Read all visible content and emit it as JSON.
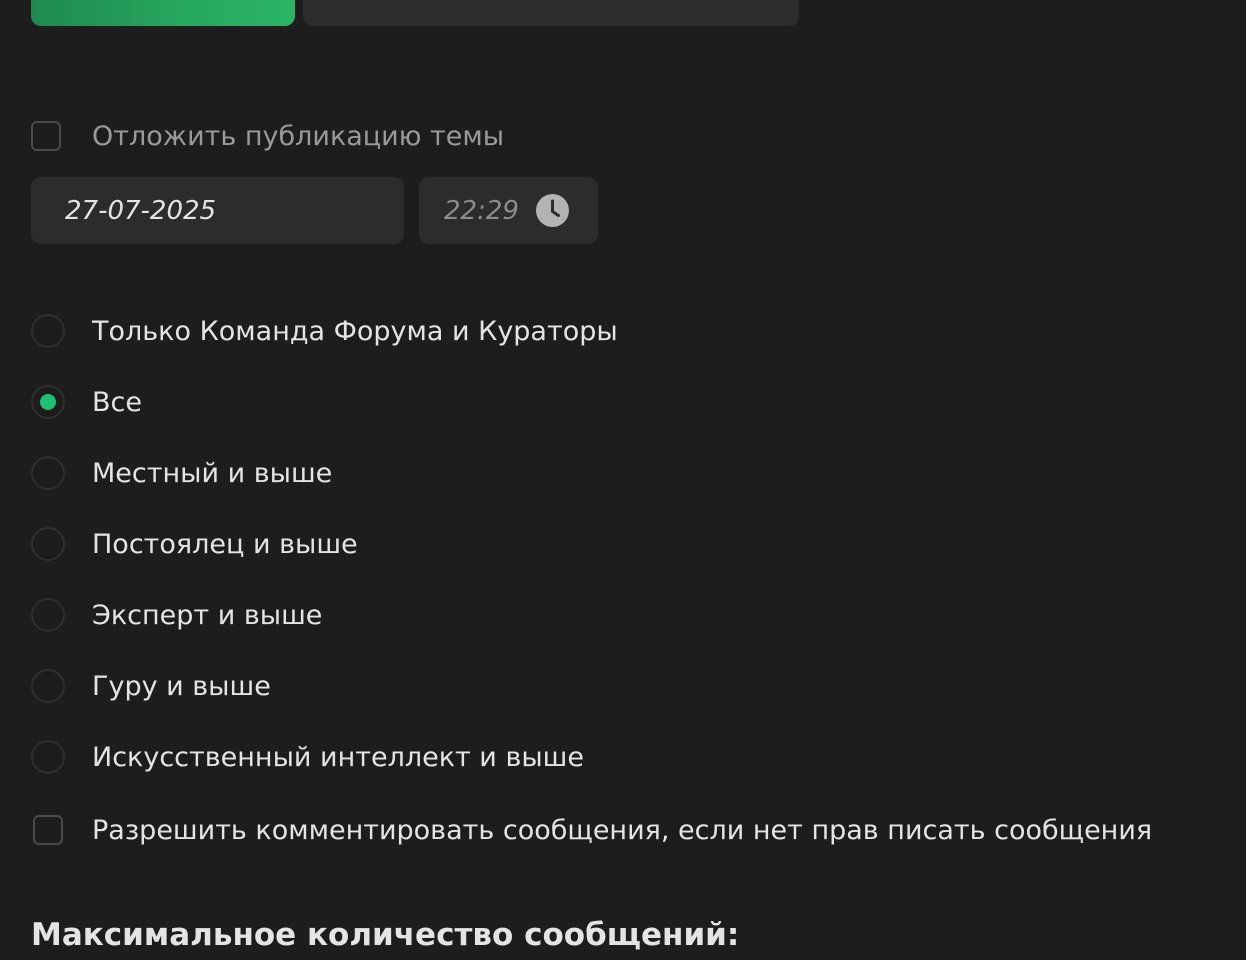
{
  "delay": {
    "checkbox_label": "Отложить публикацию темы",
    "checked": false,
    "date_value": "27-07-2025",
    "time_value": "22:29"
  },
  "access": {
    "options": [
      {
        "label": "Только Команда Форума и Кураторы",
        "checked": false
      },
      {
        "label": "Все",
        "checked": true
      },
      {
        "label": "Местный и выше",
        "checked": false
      },
      {
        "label": "Постоялец и выше",
        "checked": false
      },
      {
        "label": "Эксперт и выше",
        "checked": false
      },
      {
        "label": "Гуру и выше",
        "checked": false
      },
      {
        "label": "Искусственный интеллект и выше",
        "checked": false
      }
    ]
  },
  "comments": {
    "checkbox_label": "Разрешить комментировать сообщения, если нет прав писать сообщения",
    "checked": false
  },
  "max_messages": {
    "title": "Максимальное количество сообщений:"
  },
  "colors": {
    "background": "#1d1d1d",
    "accent": "#1ec271",
    "input_bg": "#2c2c2c"
  }
}
